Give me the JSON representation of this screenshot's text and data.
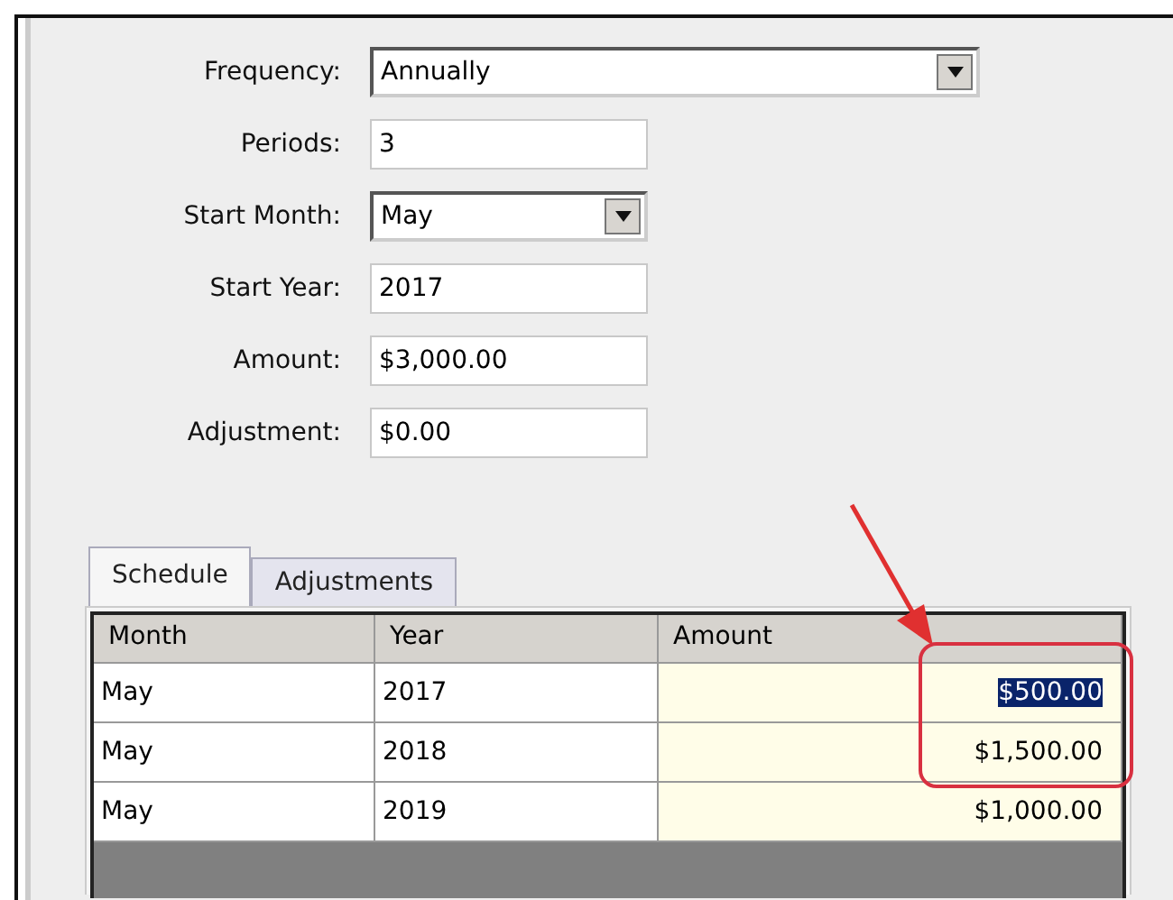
{
  "form": {
    "fields": [
      {
        "label": "Frequency:",
        "kind": "dropdown",
        "value": "Annually"
      },
      {
        "label": "Periods:",
        "kind": "text",
        "value": "3"
      },
      {
        "label": "Start Month:",
        "kind": "dropdown",
        "value": "May"
      },
      {
        "label": "Start Year:",
        "kind": "text",
        "value": "2017"
      },
      {
        "label": "Amount:",
        "kind": "text",
        "value": "$3,000.00"
      },
      {
        "label": "Adjustment:",
        "kind": "text",
        "value": "$0.00"
      }
    ]
  },
  "tabs": [
    {
      "label": "Schedule",
      "selected": true
    },
    {
      "label": "Adjustments",
      "selected": false
    }
  ],
  "table": {
    "columns": [
      "Month",
      "Year",
      "Amount"
    ],
    "rows": [
      {
        "cells": [
          "May",
          "2017",
          "$500.00"
        ],
        "selected": true
      },
      {
        "cells": [
          "May",
          "2018",
          "$1,500.00"
        ],
        "selected": false
      },
      {
        "cells": [
          "May",
          "2019",
          "$1,000.00"
        ],
        "selected": false
      }
    ]
  }
}
